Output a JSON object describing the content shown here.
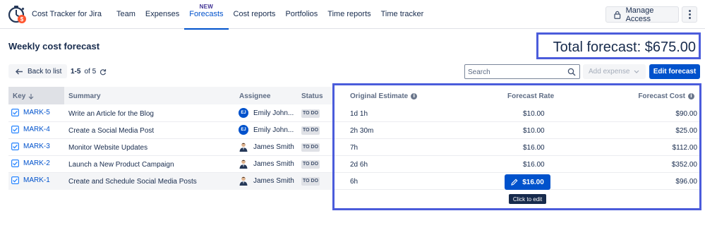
{
  "app": {
    "name": "Cost Tracker for Jira"
  },
  "nav": {
    "items": [
      {
        "label": "Team"
      },
      {
        "label": "Expenses"
      },
      {
        "label": "Forecasts",
        "badge": "NEW",
        "active": true
      },
      {
        "label": "Cost reports"
      },
      {
        "label": "Portfolios"
      },
      {
        "label": "Time reports"
      },
      {
        "label": "Time tracker"
      }
    ],
    "manage_access": "Manage Access"
  },
  "page": {
    "title": "Weekly cost forecast",
    "total_forecast": "Total forecast: $675.00"
  },
  "toolbar": {
    "back": "Back to list",
    "paging_range": "1-5",
    "paging_of": "of 5",
    "search_placeholder": "Search",
    "add_expense": "Add expense",
    "edit_forecast": "Edit forecast"
  },
  "table": {
    "headers": {
      "key": "Key",
      "summary": "Summary",
      "assignee": "Assignee",
      "status": "Status",
      "estimate": "Original Estimate",
      "rate": "Forecast Rate",
      "cost": "Forecast Cost"
    },
    "rows": [
      {
        "key": "MARK-5",
        "summary": "Write an Article for the Blog",
        "assignee": "Emily John...",
        "initials": "EJ",
        "status": "TO DO",
        "estimate": "1d 1h",
        "rate": "$10.00",
        "cost": "$90.00"
      },
      {
        "key": "MARK-4",
        "summary": "Create a Social Media Post",
        "assignee": "Emily John...",
        "initials": "EJ",
        "status": "TO DO",
        "estimate": "2h 30m",
        "rate": "$10.00",
        "cost": "$25.00"
      },
      {
        "key": "MARK-3",
        "summary": "Monitor Website Updates",
        "assignee": "James Smith",
        "initials": "",
        "status": "TO DO",
        "estimate": "7h",
        "rate": "$16.00",
        "cost": "$112.00"
      },
      {
        "key": "MARK-2",
        "summary": "Launch a New Product Campaign",
        "assignee": "James Smith",
        "initials": "",
        "status": "TO DO",
        "estimate": "2d 6h",
        "rate": "$16.00",
        "cost": "$352.00"
      },
      {
        "key": "MARK-1",
        "summary": "Create and Schedule Social Media Posts",
        "assignee": "James Smith",
        "initials": "",
        "status": "TO DO",
        "estimate": "6h",
        "rate": "$16.00",
        "cost": "$96.00"
      }
    ]
  },
  "tooltip": "Click to edit",
  "colors": {
    "accent": "#0052cc",
    "highlight": "#4b5cdb",
    "badge": "#403294"
  }
}
